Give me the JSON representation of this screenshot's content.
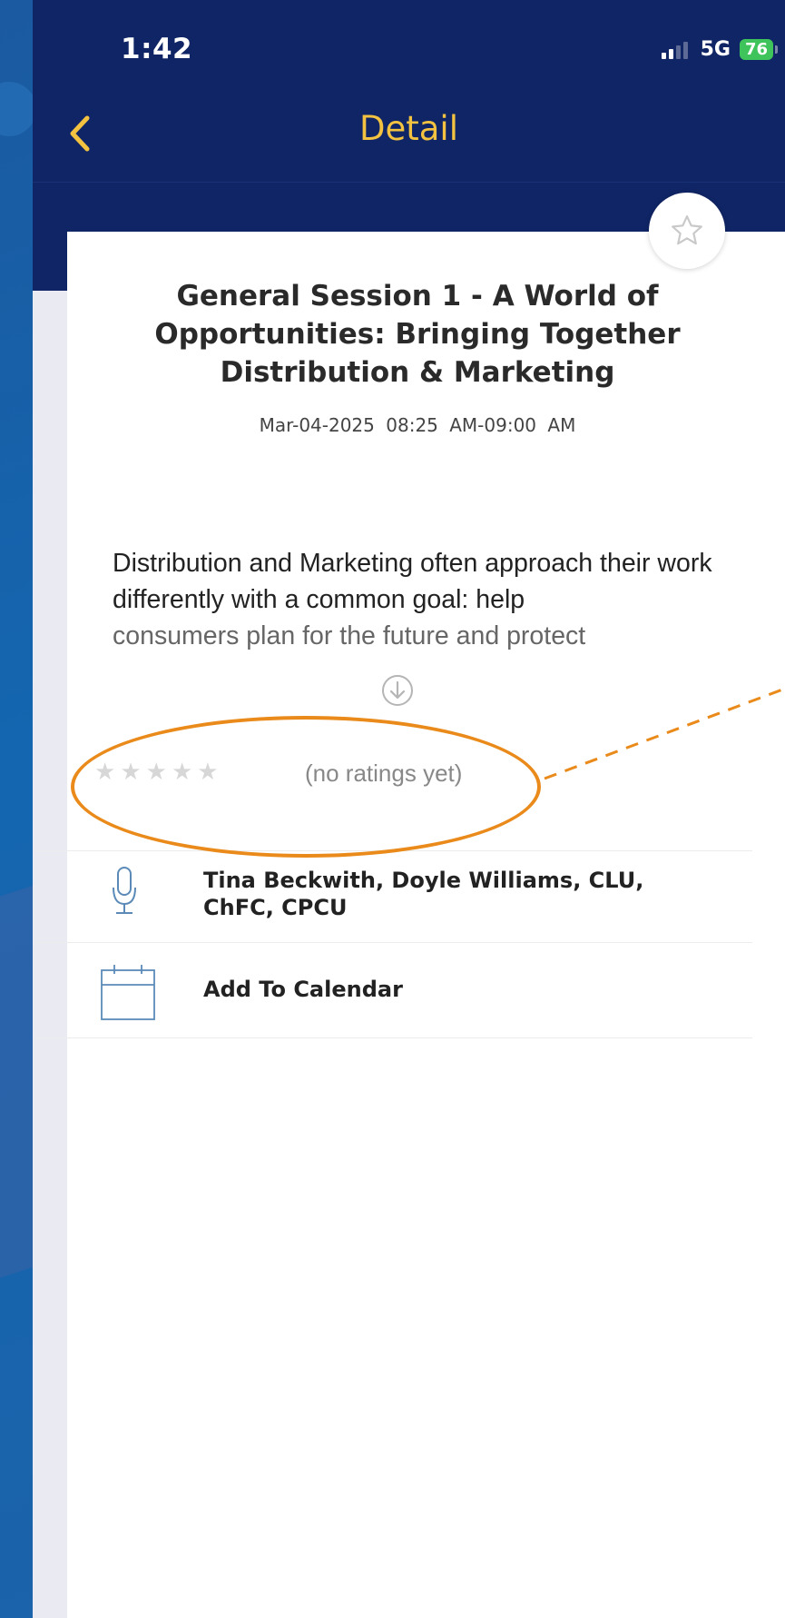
{
  "status_bar": {
    "time": "1:42",
    "network": "5G",
    "battery": "76"
  },
  "nav": {
    "title": "Detail"
  },
  "session": {
    "title": "General Session 1 - A World of Opportunities: Bringing Together Distribution & Marketing",
    "date": "Mar-04-2025",
    "time_range": "08:25 AM-09:00 AM",
    "description_line1": "Distribution and Marketing often approach their work differently with a common goal: help",
    "description_line2": "consumers plan for the future and protect"
  },
  "rating": {
    "stars_filled": 0,
    "stars_total": 5,
    "text": "(no ratings yet)"
  },
  "speakers": {
    "label": "Tina Beckwith, Doyle Williams, CLU, ChFC, CPCU"
  },
  "calendar": {
    "label": "Add To Calendar"
  },
  "colors": {
    "navy": "#102565",
    "accent": "#f2c240",
    "annotation": "#e98a1a",
    "icon_blue": "#5b8ab8"
  }
}
